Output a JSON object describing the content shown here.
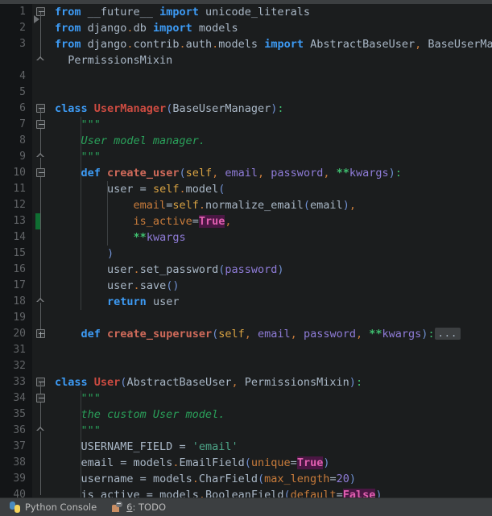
{
  "app": {
    "theme_background": "#1b1d1e",
    "gutter_background": "#131517",
    "accent_keyword": "#3d9bf5",
    "accent_class": "#cc4b41",
    "accent_string": "#2aa05a",
    "change_marker_color": "#0f6e32",
    "fold_placeholder": "..."
  },
  "editor": {
    "lines": [
      {
        "num": "1",
        "tokens": [
          {
            "t": "from",
            "c": "kw"
          },
          {
            "t": " ",
            "c": "plain"
          },
          {
            "t": "__future__",
            "c": "ident"
          },
          {
            "t": " ",
            "c": "plain"
          },
          {
            "t": "import",
            "c": "kw"
          },
          {
            "t": " ",
            "c": "plain"
          },
          {
            "t": "unicode_literals",
            "c": "ident"
          }
        ]
      },
      {
        "num": "2",
        "tokens": [
          {
            "t": "from",
            "c": "kw"
          },
          {
            "t": " django",
            "c": "ident"
          },
          {
            "t": ".",
            "c": "comma"
          },
          {
            "t": "db",
            "c": "ident"
          },
          {
            "t": " ",
            "c": "plain"
          },
          {
            "t": "import",
            "c": "kw"
          },
          {
            "t": " models",
            "c": "ident"
          }
        ]
      },
      {
        "num": "3",
        "tokens": [
          {
            "t": "from",
            "c": "kw"
          },
          {
            "t": " django",
            "c": "ident"
          },
          {
            "t": ".",
            "c": "comma"
          },
          {
            "t": "contrib",
            "c": "ident"
          },
          {
            "t": ".",
            "c": "comma"
          },
          {
            "t": "auth",
            "c": "ident"
          },
          {
            "t": ".",
            "c": "comma"
          },
          {
            "t": "models",
            "c": "ident"
          },
          {
            "t": " ",
            "c": "plain"
          },
          {
            "t": "import",
            "c": "kw"
          },
          {
            "t": " AbstractBaseUser",
            "c": "ident"
          },
          {
            "t": ",",
            "c": "comma"
          },
          {
            "t": " BaseUserManager",
            "c": "ident"
          },
          {
            "t": ",",
            "c": "comma"
          }
        ]
      },
      {
        "num": "",
        "tokens": [
          {
            "t": "  PermissionsMixin",
            "c": "ident"
          }
        ]
      },
      {
        "num": "4",
        "tokens": []
      },
      {
        "num": "5",
        "tokens": []
      },
      {
        "num": "6",
        "tokens": [
          {
            "t": "class",
            "c": "kw"
          },
          {
            "t": " ",
            "c": "plain"
          },
          {
            "t": "UserManager",
            "c": "cls"
          },
          {
            "t": "(",
            "c": "punct"
          },
          {
            "t": "BaseUserManager",
            "c": "ident"
          },
          {
            "t": ")",
            "c": "punct"
          },
          {
            "t": ":",
            "c": "green"
          }
        ]
      },
      {
        "num": "7",
        "tokens": [
          {
            "t": "    \"\"\"",
            "c": "doc"
          }
        ]
      },
      {
        "num": "8",
        "tokens": [
          {
            "t": "    User model manager.",
            "c": "doc"
          }
        ]
      },
      {
        "num": "9",
        "tokens": [
          {
            "t": "    \"\"\"",
            "c": "doc"
          }
        ]
      },
      {
        "num": "10",
        "tokens": [
          {
            "t": "    ",
            "c": "plain"
          },
          {
            "t": "def",
            "c": "kw"
          },
          {
            "t": " ",
            "c": "plain"
          },
          {
            "t": "create_user",
            "c": "fn"
          },
          {
            "t": "(",
            "c": "punct"
          },
          {
            "t": "self",
            "c": "self"
          },
          {
            "t": ",",
            "c": "comma"
          },
          {
            "t": " email",
            "c": "param"
          },
          {
            "t": ",",
            "c": "comma"
          },
          {
            "t": " password",
            "c": "param"
          },
          {
            "t": ",",
            "c": "comma"
          },
          {
            "t": " ",
            "c": "plain"
          },
          {
            "t": "**",
            "c": "star"
          },
          {
            "t": "kwargs",
            "c": "param"
          },
          {
            "t": ")",
            "c": "punct"
          },
          {
            "t": ":",
            "c": "green"
          }
        ]
      },
      {
        "num": "11",
        "tokens": [
          {
            "t": "        user ",
            "c": "ident"
          },
          {
            "t": "=",
            "c": "op"
          },
          {
            "t": " ",
            "c": "plain"
          },
          {
            "t": "self",
            "c": "self"
          },
          {
            "t": ".",
            "c": "comma"
          },
          {
            "t": "model",
            "c": "ident"
          },
          {
            "t": "(",
            "c": "punct"
          }
        ]
      },
      {
        "num": "12",
        "tokens": [
          {
            "t": "            ",
            "c": "plain"
          },
          {
            "t": "email",
            "c": "kwarg"
          },
          {
            "t": "=",
            "c": "op"
          },
          {
            "t": "self",
            "c": "self"
          },
          {
            "t": ".",
            "c": "comma"
          },
          {
            "t": "normalize_email",
            "c": "ident"
          },
          {
            "t": "(",
            "c": "punct"
          },
          {
            "t": "email",
            "c": "ident"
          },
          {
            "t": ")",
            "c": "punct"
          },
          {
            "t": ",",
            "c": "comma"
          }
        ]
      },
      {
        "num": "13",
        "changed": true,
        "tokens": [
          {
            "t": "            ",
            "c": "plain"
          },
          {
            "t": "is_active",
            "c": "kwarg"
          },
          {
            "t": "=",
            "c": "op"
          },
          {
            "t": "True",
            "c": "bool"
          },
          {
            "t": ",",
            "c": "comma"
          }
        ]
      },
      {
        "num": "14",
        "tokens": [
          {
            "t": "            ",
            "c": "plain"
          },
          {
            "t": "**",
            "c": "star"
          },
          {
            "t": "kwargs",
            "c": "param"
          }
        ]
      },
      {
        "num": "15",
        "tokens": [
          {
            "t": "        ",
            "c": "plain"
          },
          {
            "t": ")",
            "c": "punct"
          }
        ]
      },
      {
        "num": "16",
        "tokens": [
          {
            "t": "        user",
            "c": "ident"
          },
          {
            "t": ".",
            "c": "comma"
          },
          {
            "t": "set_password",
            "c": "ident"
          },
          {
            "t": "(",
            "c": "punct"
          },
          {
            "t": "password",
            "c": "param"
          },
          {
            "t": ")",
            "c": "punct"
          }
        ]
      },
      {
        "num": "17",
        "tokens": [
          {
            "t": "        user",
            "c": "ident"
          },
          {
            "t": ".",
            "c": "comma"
          },
          {
            "t": "save",
            "c": "ident"
          },
          {
            "t": "(",
            "c": "punct"
          },
          {
            "t": ")",
            "c": "punct"
          }
        ]
      },
      {
        "num": "18",
        "tokens": [
          {
            "t": "        ",
            "c": "plain"
          },
          {
            "t": "return",
            "c": "kw"
          },
          {
            "t": " user",
            "c": "ident"
          }
        ]
      },
      {
        "num": "19",
        "tokens": []
      },
      {
        "num": "20",
        "folded": true,
        "tokens": [
          {
            "t": "    ",
            "c": "plain"
          },
          {
            "t": "def",
            "c": "kw"
          },
          {
            "t": " ",
            "c": "plain"
          },
          {
            "t": "create_superuser",
            "c": "fn"
          },
          {
            "t": "(",
            "c": "punct"
          },
          {
            "t": "self",
            "c": "self"
          },
          {
            "t": ",",
            "c": "comma"
          },
          {
            "t": " email",
            "c": "param"
          },
          {
            "t": ",",
            "c": "comma"
          },
          {
            "t": " password",
            "c": "param"
          },
          {
            "t": ",",
            "c": "comma"
          },
          {
            "t": " ",
            "c": "plain"
          },
          {
            "t": "**",
            "c": "star"
          },
          {
            "t": "kwargs",
            "c": "param"
          },
          {
            "t": ")",
            "c": "punct"
          },
          {
            "t": ":",
            "c": "green"
          }
        ]
      },
      {
        "num": "31",
        "tokens": []
      },
      {
        "num": "32",
        "tokens": []
      },
      {
        "num": "33",
        "tokens": [
          {
            "t": "class",
            "c": "kw"
          },
          {
            "t": " ",
            "c": "plain"
          },
          {
            "t": "User",
            "c": "cls"
          },
          {
            "t": "(",
            "c": "punct"
          },
          {
            "t": "AbstractBaseUser",
            "c": "ident"
          },
          {
            "t": ",",
            "c": "comma"
          },
          {
            "t": " PermissionsMixin",
            "c": "ident"
          },
          {
            "t": ")",
            "c": "punct"
          },
          {
            "t": ":",
            "c": "green"
          }
        ]
      },
      {
        "num": "34",
        "tokens": [
          {
            "t": "    \"\"\"",
            "c": "doc"
          }
        ]
      },
      {
        "num": "35",
        "tokens": [
          {
            "t": "    the custom User model.",
            "c": "doc"
          }
        ]
      },
      {
        "num": "36",
        "tokens": [
          {
            "t": "    \"\"\"",
            "c": "doc"
          }
        ]
      },
      {
        "num": "37",
        "tokens": [
          {
            "t": "    USERNAME_FIELD ",
            "c": "ident"
          },
          {
            "t": "=",
            "c": "op"
          },
          {
            "t": " ",
            "c": "plain"
          },
          {
            "t": "'email'",
            "c": "str"
          }
        ]
      },
      {
        "num": "38",
        "tokens": [
          {
            "t": "    email ",
            "c": "ident"
          },
          {
            "t": "=",
            "c": "op"
          },
          {
            "t": " models",
            "c": "ident"
          },
          {
            "t": ".",
            "c": "comma"
          },
          {
            "t": "EmailField",
            "c": "ident"
          },
          {
            "t": "(",
            "c": "punct"
          },
          {
            "t": "unique",
            "c": "kwarg"
          },
          {
            "t": "=",
            "c": "op"
          },
          {
            "t": "True",
            "c": "bool"
          },
          {
            "t": ")",
            "c": "punct"
          }
        ]
      },
      {
        "num": "39",
        "tokens": [
          {
            "t": "    username ",
            "c": "ident"
          },
          {
            "t": "=",
            "c": "op"
          },
          {
            "t": " models",
            "c": "ident"
          },
          {
            "t": ".",
            "c": "comma"
          },
          {
            "t": "CharField",
            "c": "ident"
          },
          {
            "t": "(",
            "c": "punct"
          },
          {
            "t": "max_length",
            "c": "kwarg"
          },
          {
            "t": "=",
            "c": "op"
          },
          {
            "t": "20",
            "c": "num"
          },
          {
            "t": ")",
            "c": "punct"
          }
        ]
      },
      {
        "num": "40",
        "tokens": [
          {
            "t": "    is_active ",
            "c": "ident"
          },
          {
            "t": "=",
            "c": "op"
          },
          {
            "t": " models",
            "c": "ident"
          },
          {
            "t": ".",
            "c": "comma"
          },
          {
            "t": "BooleanField",
            "c": "ident"
          },
          {
            "t": "(",
            "c": "punct"
          },
          {
            "t": "default",
            "c": "kwarg"
          },
          {
            "t": "=",
            "c": "op"
          },
          {
            "t": "False",
            "c": "bool"
          },
          {
            "t": ")",
            "c": "punct"
          }
        ]
      }
    ]
  },
  "statusbar": {
    "items": [
      {
        "icon": "python-console-icon",
        "label": "Python Console",
        "mnemonic": ""
      },
      {
        "icon": "todo-icon",
        "label": ": TODO",
        "mnemonic": "6"
      }
    ]
  }
}
